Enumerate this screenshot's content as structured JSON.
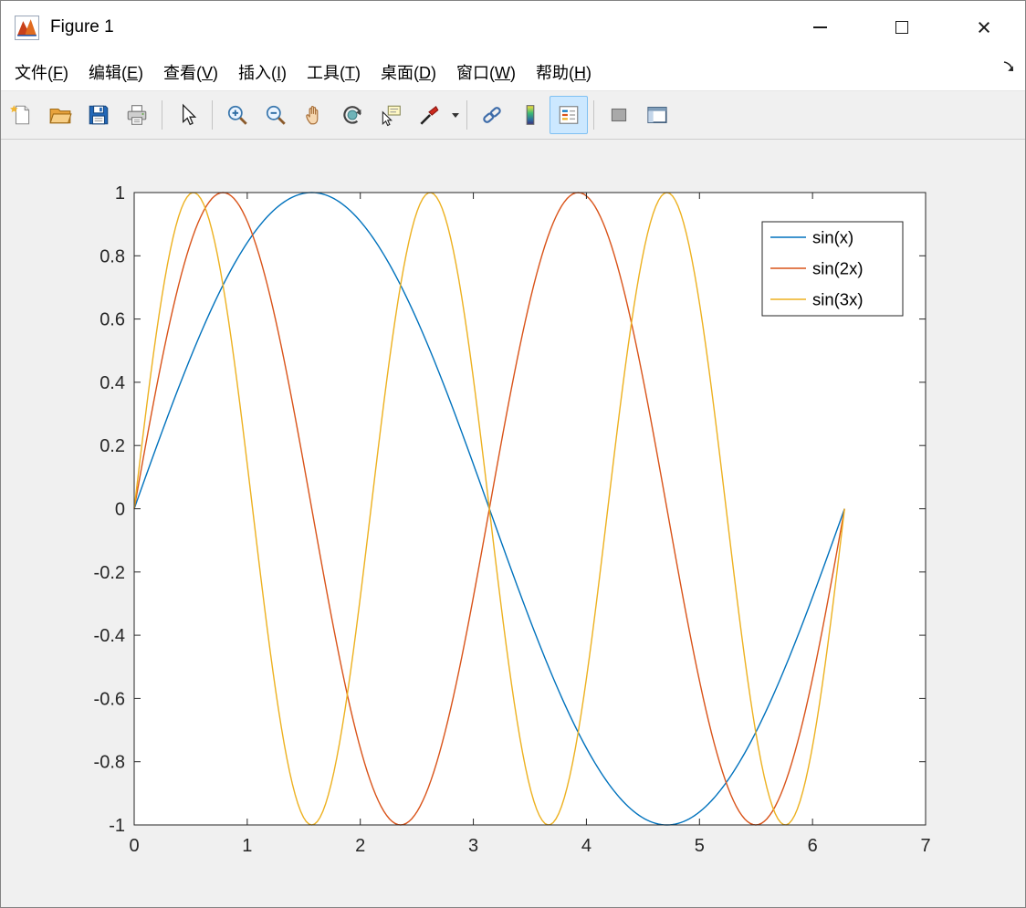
{
  "window": {
    "title": "Figure 1",
    "controls": [
      "minimize",
      "maximize",
      "close"
    ]
  },
  "menu": {
    "items": [
      "文件(F)",
      "编辑(E)",
      "查看(V)",
      "插入(I)",
      "工具(T)",
      "桌面(D)",
      "窗口(W)",
      "帮助(H)"
    ]
  },
  "toolbar": {
    "buttons": [
      "new-figure",
      "open-file",
      "save-figure",
      "print-figure",
      "pointer",
      "zoom-in",
      "zoom-out",
      "pan",
      "rotate-3d",
      "data-cursor",
      "brush-data",
      "link-plot",
      "insert-colorbar",
      "insert-legend",
      "hide-plot-tools",
      "show-plot-tools"
    ],
    "legend_button_toggled": true
  },
  "chart_data": {
    "type": "line",
    "title": "",
    "xlabel": "",
    "ylabel": "",
    "xlim": [
      0,
      7
    ],
    "ylim": [
      -1,
      1
    ],
    "x_ticks": [
      0,
      1,
      2,
      3,
      4,
      5,
      6,
      7
    ],
    "x_tick_labels": [
      "0",
      "1",
      "2",
      "3",
      "4",
      "5",
      "6",
      "7"
    ],
    "y_ticks": [
      -1,
      -0.8,
      -0.6,
      -0.4,
      -0.2,
      0,
      0.2,
      0.4,
      0.6,
      0.8,
      1
    ],
    "y_tick_labels": [
      "-1",
      "-0.8",
      "-0.6",
      "-0.4",
      "-0.2",
      "0",
      "0.2",
      "0.4",
      "0.6",
      "0.8",
      "1"
    ],
    "x_range": [
      0,
      6.2832
    ],
    "x_samples": 256,
    "grid": false,
    "box": true,
    "legend_position": "northeast",
    "axis_color": "#262626",
    "series": [
      {
        "name": "sin(x)",
        "expression": "sin(1*x)",
        "k": 1,
        "color": "#0072BD"
      },
      {
        "name": "sin(2x)",
        "expression": "sin(2*x)",
        "k": 2,
        "color": "#D95319"
      },
      {
        "name": "sin(3x)",
        "expression": "sin(3*x)",
        "k": 3,
        "color": "#EDB120"
      }
    ]
  }
}
